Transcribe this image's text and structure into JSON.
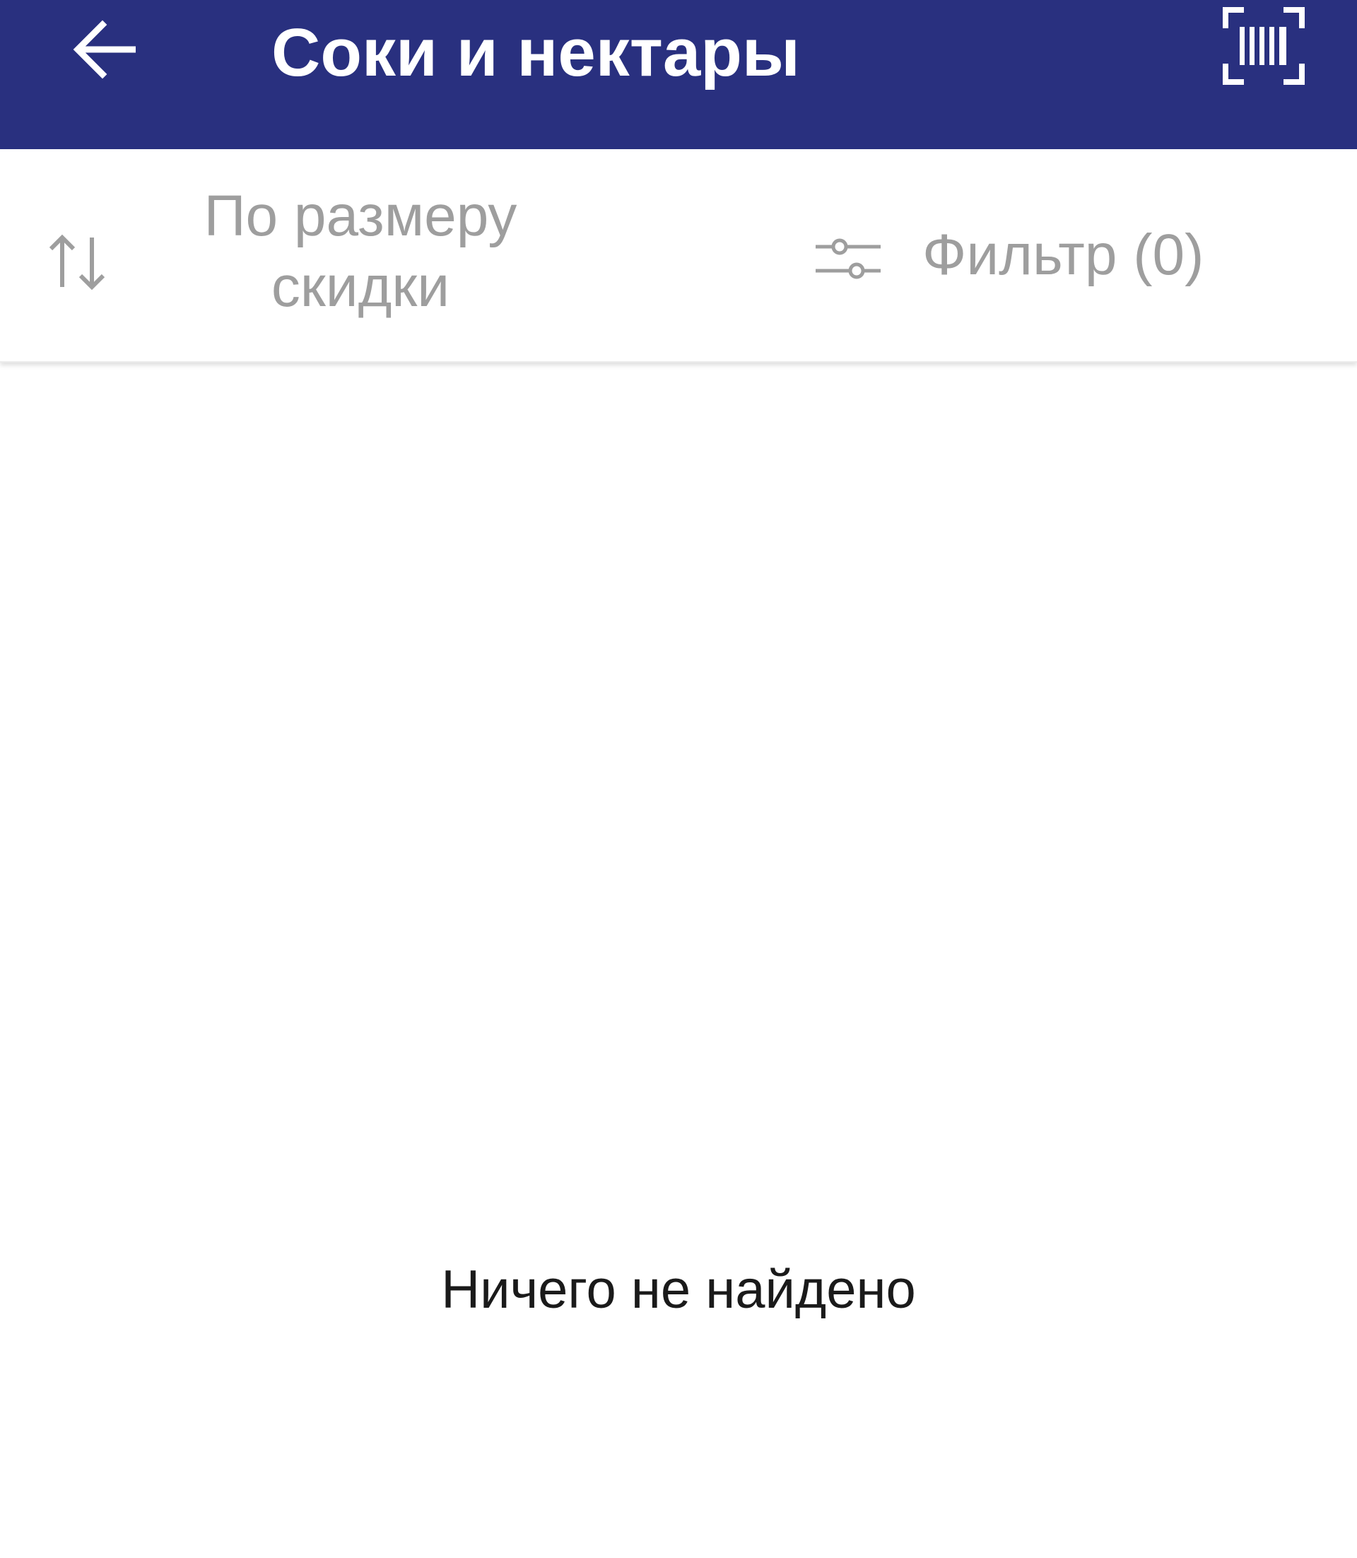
{
  "header": {
    "title": "Соки и нектары",
    "background": "#29307f",
    "back_icon": "arrow-left-icon",
    "scan_icon": "barcode-scan-icon"
  },
  "toolbar": {
    "sort": {
      "icon": "sort-arrows-icon",
      "label_line1": "По размеру",
      "label_line2": "скидки"
    },
    "filter": {
      "icon": "sliders-icon",
      "label": "Фильтр (0)"
    },
    "text_color": "#9e9e9e"
  },
  "content": {
    "empty_message": "Ничего не найдено"
  }
}
